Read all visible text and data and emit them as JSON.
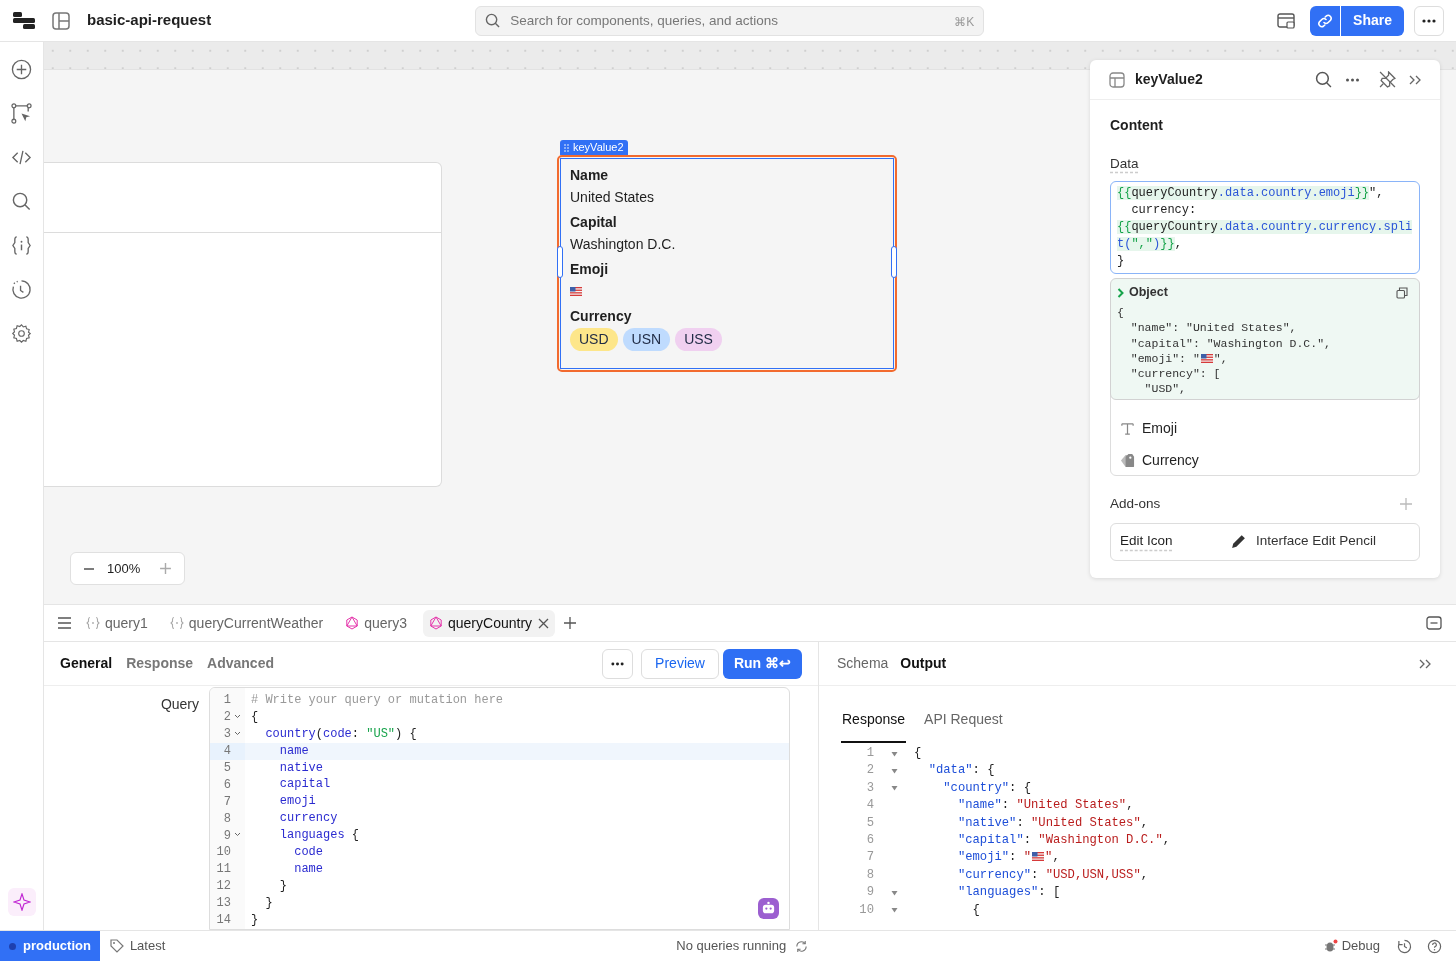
{
  "app": {
    "title": "basic-api-request",
    "search_placeholder": "Search for components, queries, and actions",
    "search_shortcut": "⌘K",
    "share": "Share"
  },
  "zoom": {
    "value": "100%"
  },
  "component": {
    "label": "keyValue2",
    "fields": [
      {
        "key": "Name",
        "kind": "text",
        "value": "United States"
      },
      {
        "key": "Capital",
        "kind": "text",
        "value": "Washington D.C."
      },
      {
        "key": "Emoji",
        "kind": "flag"
      },
      {
        "key": "Currency",
        "kind": "tags",
        "tags": [
          {
            "label": "USD",
            "color": "#fde68a"
          },
          {
            "label": "USN",
            "color": "#bfdbfe"
          },
          {
            "label": "USS",
            "color": "#f0d0f0"
          }
        ]
      }
    ]
  },
  "inspector": {
    "title": "keyValue2",
    "section": "Content",
    "data_label": "Data",
    "data_lines": [
      [
        {
          "kind": "brace",
          "text": "{{"
        },
        {
          "kind": "var",
          "text": "queryCountry"
        },
        {
          "kind": "prop",
          "text": ".data.country.emoji"
        },
        {
          "kind": "brace",
          "text": "}}"
        },
        {
          "kind": "plain",
          "text": "\","
        }
      ],
      [
        {
          "kind": "plain",
          "text": "  currency:"
        }
      ],
      [
        {
          "kind": "brace",
          "text": "{{"
        },
        {
          "kind": "var",
          "text": "queryCountry"
        },
        {
          "kind": "prop",
          "text": ".data.country.currency.spli"
        }
      ],
      [
        {
          "kind": "prop",
          "text": "t("
        },
        {
          "kind": "str",
          "text": "\",\""
        },
        {
          "kind": "prop",
          "text": ")"
        },
        {
          "kind": "brace",
          "text": "}}"
        },
        {
          "kind": "plain",
          "text": ","
        }
      ],
      [
        {
          "kind": "plain",
          "text": "}"
        }
      ]
    ],
    "preview_title": "Object",
    "preview_lines": [
      [
        {
          "kind": "plain",
          "text": "{"
        }
      ],
      [
        {
          "kind": "plain",
          "text": "  \"name\": \"United States\","
        }
      ],
      [
        {
          "kind": "plain",
          "text": "  \"capital\": \"Washington D.C.\","
        }
      ],
      [
        {
          "kind": "plain",
          "text": "  \"emoji\": \""
        },
        {
          "kind": "flag"
        },
        {
          "kind": "plain",
          "text": "\","
        }
      ],
      [
        {
          "kind": "plain",
          "text": "  \"currency\": ["
        }
      ],
      [
        {
          "kind": "plain",
          "text": "    \"USD\","
        }
      ]
    ],
    "fields": [
      {
        "label": "Emoji",
        "kind": "text"
      },
      {
        "label": "Currency",
        "kind": "tags"
      }
    ],
    "addons_label": "Add-ons",
    "addon": {
      "label": "Edit Icon",
      "value": "Interface Edit Pencil"
    }
  },
  "query_tabs": [
    {
      "label": "query1",
      "kind": "rest",
      "selected": false
    },
    {
      "label": "queryCurrentWeather",
      "kind": "rest",
      "selected": false
    },
    {
      "label": "query3",
      "kind": "graphql",
      "selected": false
    },
    {
      "label": "queryCountry",
      "kind": "graphql",
      "selected": true
    }
  ],
  "query_editor": {
    "tabs": [
      {
        "label": "General",
        "selected": true
      },
      {
        "label": "Response",
        "selected": false
      },
      {
        "label": "Advanced",
        "selected": false
      }
    ],
    "preview": "Preview",
    "run": "Run ⌘↩",
    "field_label": "Query",
    "lines": [
      {
        "no": "1",
        "fold": false,
        "active": false,
        "tokens": [
          {
            "kind": "comment",
            "text": "# Write your query or mutation here"
          }
        ]
      },
      {
        "no": "2",
        "fold": true,
        "active": false,
        "tokens": [
          {
            "kind": "punct",
            "text": "{"
          }
        ]
      },
      {
        "no": "3",
        "fold": true,
        "active": false,
        "tokens": [
          {
            "kind": "field",
            "text": "  country"
          },
          {
            "kind": "punct",
            "text": "("
          },
          {
            "kind": "field",
            "text": "code"
          },
          {
            "kind": "punct",
            "text": ": "
          },
          {
            "kind": "str",
            "text": "\"US\""
          },
          {
            "kind": "punct",
            "text": ") {"
          }
        ]
      },
      {
        "no": "4",
        "fold": false,
        "active": true,
        "tokens": [
          {
            "kind": "field",
            "text": "    name"
          }
        ]
      },
      {
        "no": "5",
        "fold": false,
        "active": false,
        "tokens": [
          {
            "kind": "field",
            "text": "    native"
          }
        ]
      },
      {
        "no": "6",
        "fold": false,
        "active": false,
        "tokens": [
          {
            "kind": "field",
            "text": "    capital"
          }
        ]
      },
      {
        "no": "7",
        "fold": false,
        "active": false,
        "tokens": [
          {
            "kind": "field",
            "text": "    emoji"
          }
        ]
      },
      {
        "no": "8",
        "fold": false,
        "active": false,
        "tokens": [
          {
            "kind": "field",
            "text": "    currency"
          }
        ]
      },
      {
        "no": "9",
        "fold": true,
        "active": false,
        "tokens": [
          {
            "kind": "field",
            "text": "    languages"
          },
          {
            "kind": "punct",
            "text": " {"
          }
        ]
      },
      {
        "no": "10",
        "fold": false,
        "active": false,
        "tokens": [
          {
            "kind": "field",
            "text": "      code"
          }
        ]
      },
      {
        "no": "11",
        "fold": false,
        "active": false,
        "tokens": [
          {
            "kind": "field",
            "text": "      name"
          }
        ]
      },
      {
        "no": "12",
        "fold": false,
        "active": false,
        "tokens": [
          {
            "kind": "punct",
            "text": "    }"
          }
        ]
      },
      {
        "no": "13",
        "fold": false,
        "active": false,
        "tokens": [
          {
            "kind": "punct",
            "text": "  }"
          }
        ]
      },
      {
        "no": "14",
        "fold": false,
        "active": false,
        "tokens": [
          {
            "kind": "punct",
            "text": "}"
          }
        ]
      }
    ]
  },
  "output": {
    "tabs": [
      {
        "label": "Schema",
        "selected": false
      },
      {
        "label": "Output",
        "selected": true
      }
    ],
    "subtabs": [
      {
        "label": "Response",
        "selected": true
      },
      {
        "label": "API Request",
        "selected": false
      }
    ],
    "lines": [
      {
        "no": "1",
        "fold": true,
        "tokens": [
          {
            "kind": "punct",
            "text": "{"
          }
        ]
      },
      {
        "no": "2",
        "fold": true,
        "tokens": [
          {
            "kind": "key",
            "text": "  \"data\""
          },
          {
            "kind": "punct",
            "text": ": {"
          }
        ]
      },
      {
        "no": "3",
        "fold": true,
        "tokens": [
          {
            "kind": "key",
            "text": "    \"country\""
          },
          {
            "kind": "punct",
            "text": ": {"
          }
        ]
      },
      {
        "no": "4",
        "fold": false,
        "tokens": [
          {
            "kind": "key",
            "text": "      \"name\""
          },
          {
            "kind": "punct",
            "text": ": "
          },
          {
            "kind": "str",
            "text": "\"United States\""
          },
          {
            "kind": "punct",
            "text": ","
          }
        ]
      },
      {
        "no": "5",
        "fold": false,
        "tokens": [
          {
            "kind": "key",
            "text": "      \"native\""
          },
          {
            "kind": "punct",
            "text": ": "
          },
          {
            "kind": "str",
            "text": "\"United States\""
          },
          {
            "kind": "punct",
            "text": ","
          }
        ]
      },
      {
        "no": "6",
        "fold": false,
        "tokens": [
          {
            "kind": "key",
            "text": "      \"capital\""
          },
          {
            "kind": "punct",
            "text": ": "
          },
          {
            "kind": "str",
            "text": "\"Washington D.C.\""
          },
          {
            "kind": "punct",
            "text": ","
          }
        ]
      },
      {
        "no": "7",
        "fold": false,
        "tokens": [
          {
            "kind": "key",
            "text": "      \"emoji\""
          },
          {
            "kind": "punct",
            "text": ": "
          },
          {
            "kind": "str",
            "text": "\""
          },
          {
            "kind": "flag"
          },
          {
            "kind": "str",
            "text": "\""
          },
          {
            "kind": "punct",
            "text": ","
          }
        ]
      },
      {
        "no": "8",
        "fold": false,
        "tokens": [
          {
            "kind": "key",
            "text": "      \"currency\""
          },
          {
            "kind": "punct",
            "text": ": "
          },
          {
            "kind": "str",
            "text": "\"USD,USN,USS\""
          },
          {
            "kind": "punct",
            "text": ","
          }
        ]
      },
      {
        "no": "9",
        "fold": true,
        "tokens": [
          {
            "kind": "key",
            "text": "      \"languages\""
          },
          {
            "kind": "punct",
            "text": ": ["
          }
        ]
      },
      {
        "no": "10",
        "fold": true,
        "tokens": [
          {
            "kind": "punct",
            "text": "        {"
          }
        ]
      }
    ]
  },
  "status": {
    "env": "production",
    "version": "Latest",
    "queries": "No queries running",
    "debug": "Debug"
  }
}
